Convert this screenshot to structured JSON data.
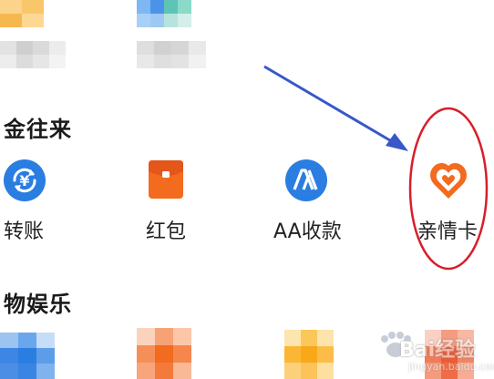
{
  "sections": [
    {
      "title": "金往来",
      "items": [
        {
          "label": "转账",
          "icon": "transfer-icon"
        },
        {
          "label": "红包",
          "icon": "red-envelope-icon"
        },
        {
          "label": "AA收款",
          "icon": "aa-payment-icon"
        },
        {
          "label": "亲情卡",
          "icon": "family-card-icon"
        }
      ]
    },
    {
      "title": "物娱乐",
      "items": [
        {
          "label": "",
          "icon": "blurred-blue-icon"
        },
        {
          "label": "",
          "icon": "blurred-orange-icon"
        },
        {
          "label": "",
          "icon": "blurred-yellow-icon"
        },
        {
          "label": "",
          "icon": "blurred-red-icon"
        }
      ]
    }
  ],
  "watermark": {
    "text": "Bai经验",
    "url": "jingyan.baidu.com"
  },
  "colors": {
    "blue": "#2a7de1",
    "orange": "#f26b1f",
    "annotation_red": "#d81e2a",
    "arrow_blue": "#3857c9"
  }
}
